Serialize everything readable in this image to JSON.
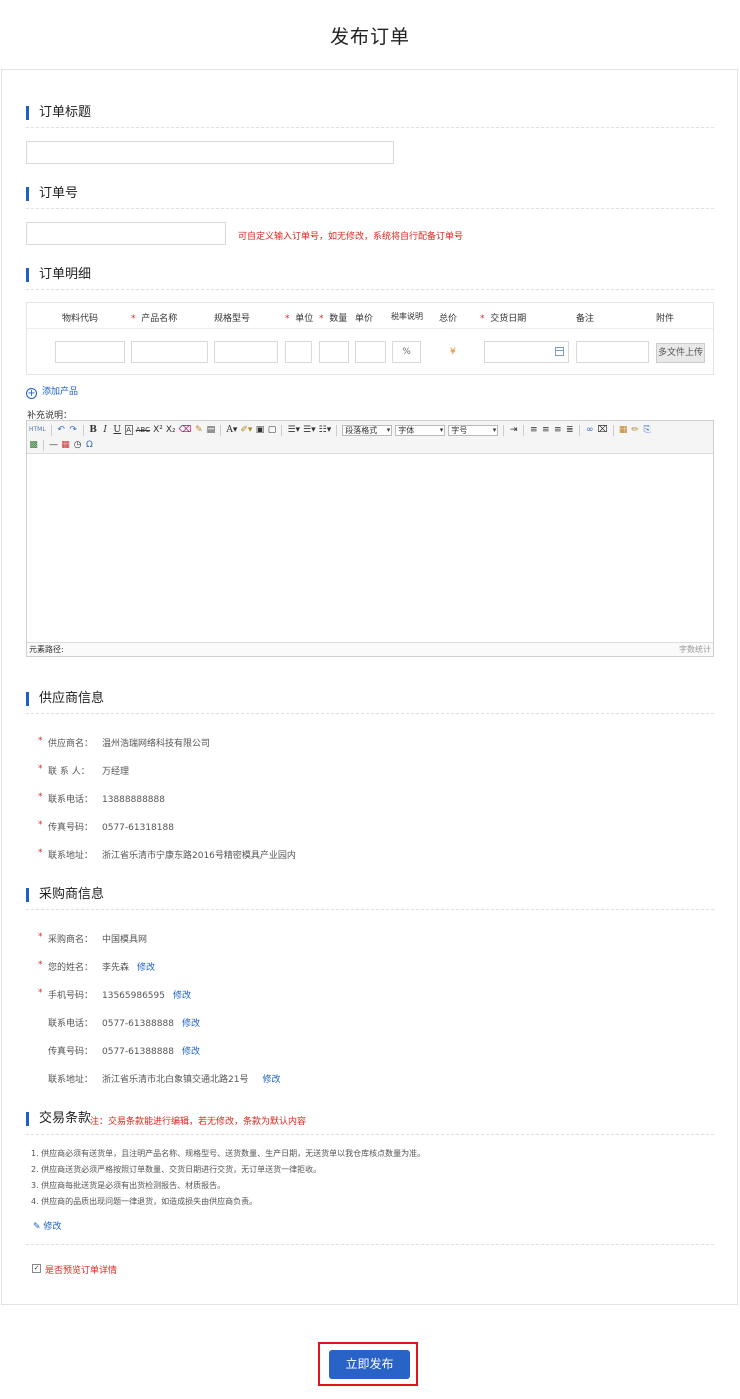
{
  "page_title": "发布订单",
  "order_title": {
    "label": "订单标题",
    "value": ""
  },
  "order_no": {
    "label": "订单号",
    "value": "",
    "hint": "可自定义输入订单号，如无修改，系统将自行配备订单号"
  },
  "order_detail": {
    "label": "订单明细",
    "columns": [
      "物料代码",
      "产品名称",
      "规格型号",
      "单位",
      "数量",
      "单价",
      "税率说明",
      "总价",
      "交货日期",
      "备注",
      "附件"
    ],
    "tax_suffix": "%",
    "total_symbol": "¥",
    "upload_label": "多文件上传",
    "add_product": "添加产品"
  },
  "extra": {
    "label": "补充说明：",
    "toolbar": {
      "html": "HTML",
      "paragraph_format": "段落格式",
      "font": "字体",
      "font_size": "字号"
    },
    "status_path": "元素路径:",
    "word_count": "字数统计"
  },
  "supplier": {
    "label": "供应商信息",
    "rows": [
      {
        "label": "供应商名：",
        "value": "温州浩瑞网络科技有限公司"
      },
      {
        "label": "联 系 人：",
        "value": "万经理"
      },
      {
        "label": "联系电话：",
        "value": "13888888888"
      },
      {
        "label": "传真号码：",
        "value": "0577-61318188"
      },
      {
        "label": "联系地址：",
        "value": "浙江省乐清市宁康东路2016号精密模具产业园内"
      }
    ]
  },
  "buyer": {
    "label": "采购商信息",
    "rows": [
      {
        "label": "采购商名：",
        "value": "中国模具网",
        "edit": ""
      },
      {
        "label": "您的姓名：",
        "value": "李先森",
        "edit": "修改"
      },
      {
        "label": "手机号码：",
        "value": "13565986595",
        "edit": "修改"
      },
      {
        "label": "联系电话：",
        "value": "0577-61388888",
        "edit": "修改"
      },
      {
        "label": "传真号码：",
        "value": "0577-61388888",
        "edit": "修改"
      },
      {
        "label": "联系地址：",
        "value": "浙江省乐清市北白象镇交通北路21号",
        "edit": "修改"
      }
    ]
  },
  "terms": {
    "label": "交易条款",
    "note": "注：交易条款能进行编辑，若无修改，条款为默认内容",
    "items": [
      "1. 供应商必须有送货单，且注明产品名称、规格型号、送货数量、生产日期，无送货单以我仓库核点数量为准。",
      "2. 供应商送货必须严格按照订单数量、交货日期进行交货，无订单送货一律拒收。",
      "3. 供应商每批送货是必须有出货检测报告、材质报告。",
      "4. 供应商的品质出现问题一律退货，如造成损失由供应商负责。"
    ],
    "edit": "修改"
  },
  "preview": {
    "checked": true,
    "label": "是否预览订单详情",
    "mark": "✓"
  },
  "submit_label": "立即发布",
  "colors": {
    "accent": "#2a63c8",
    "red": "#d9281e",
    "orange": "#e0801e"
  }
}
